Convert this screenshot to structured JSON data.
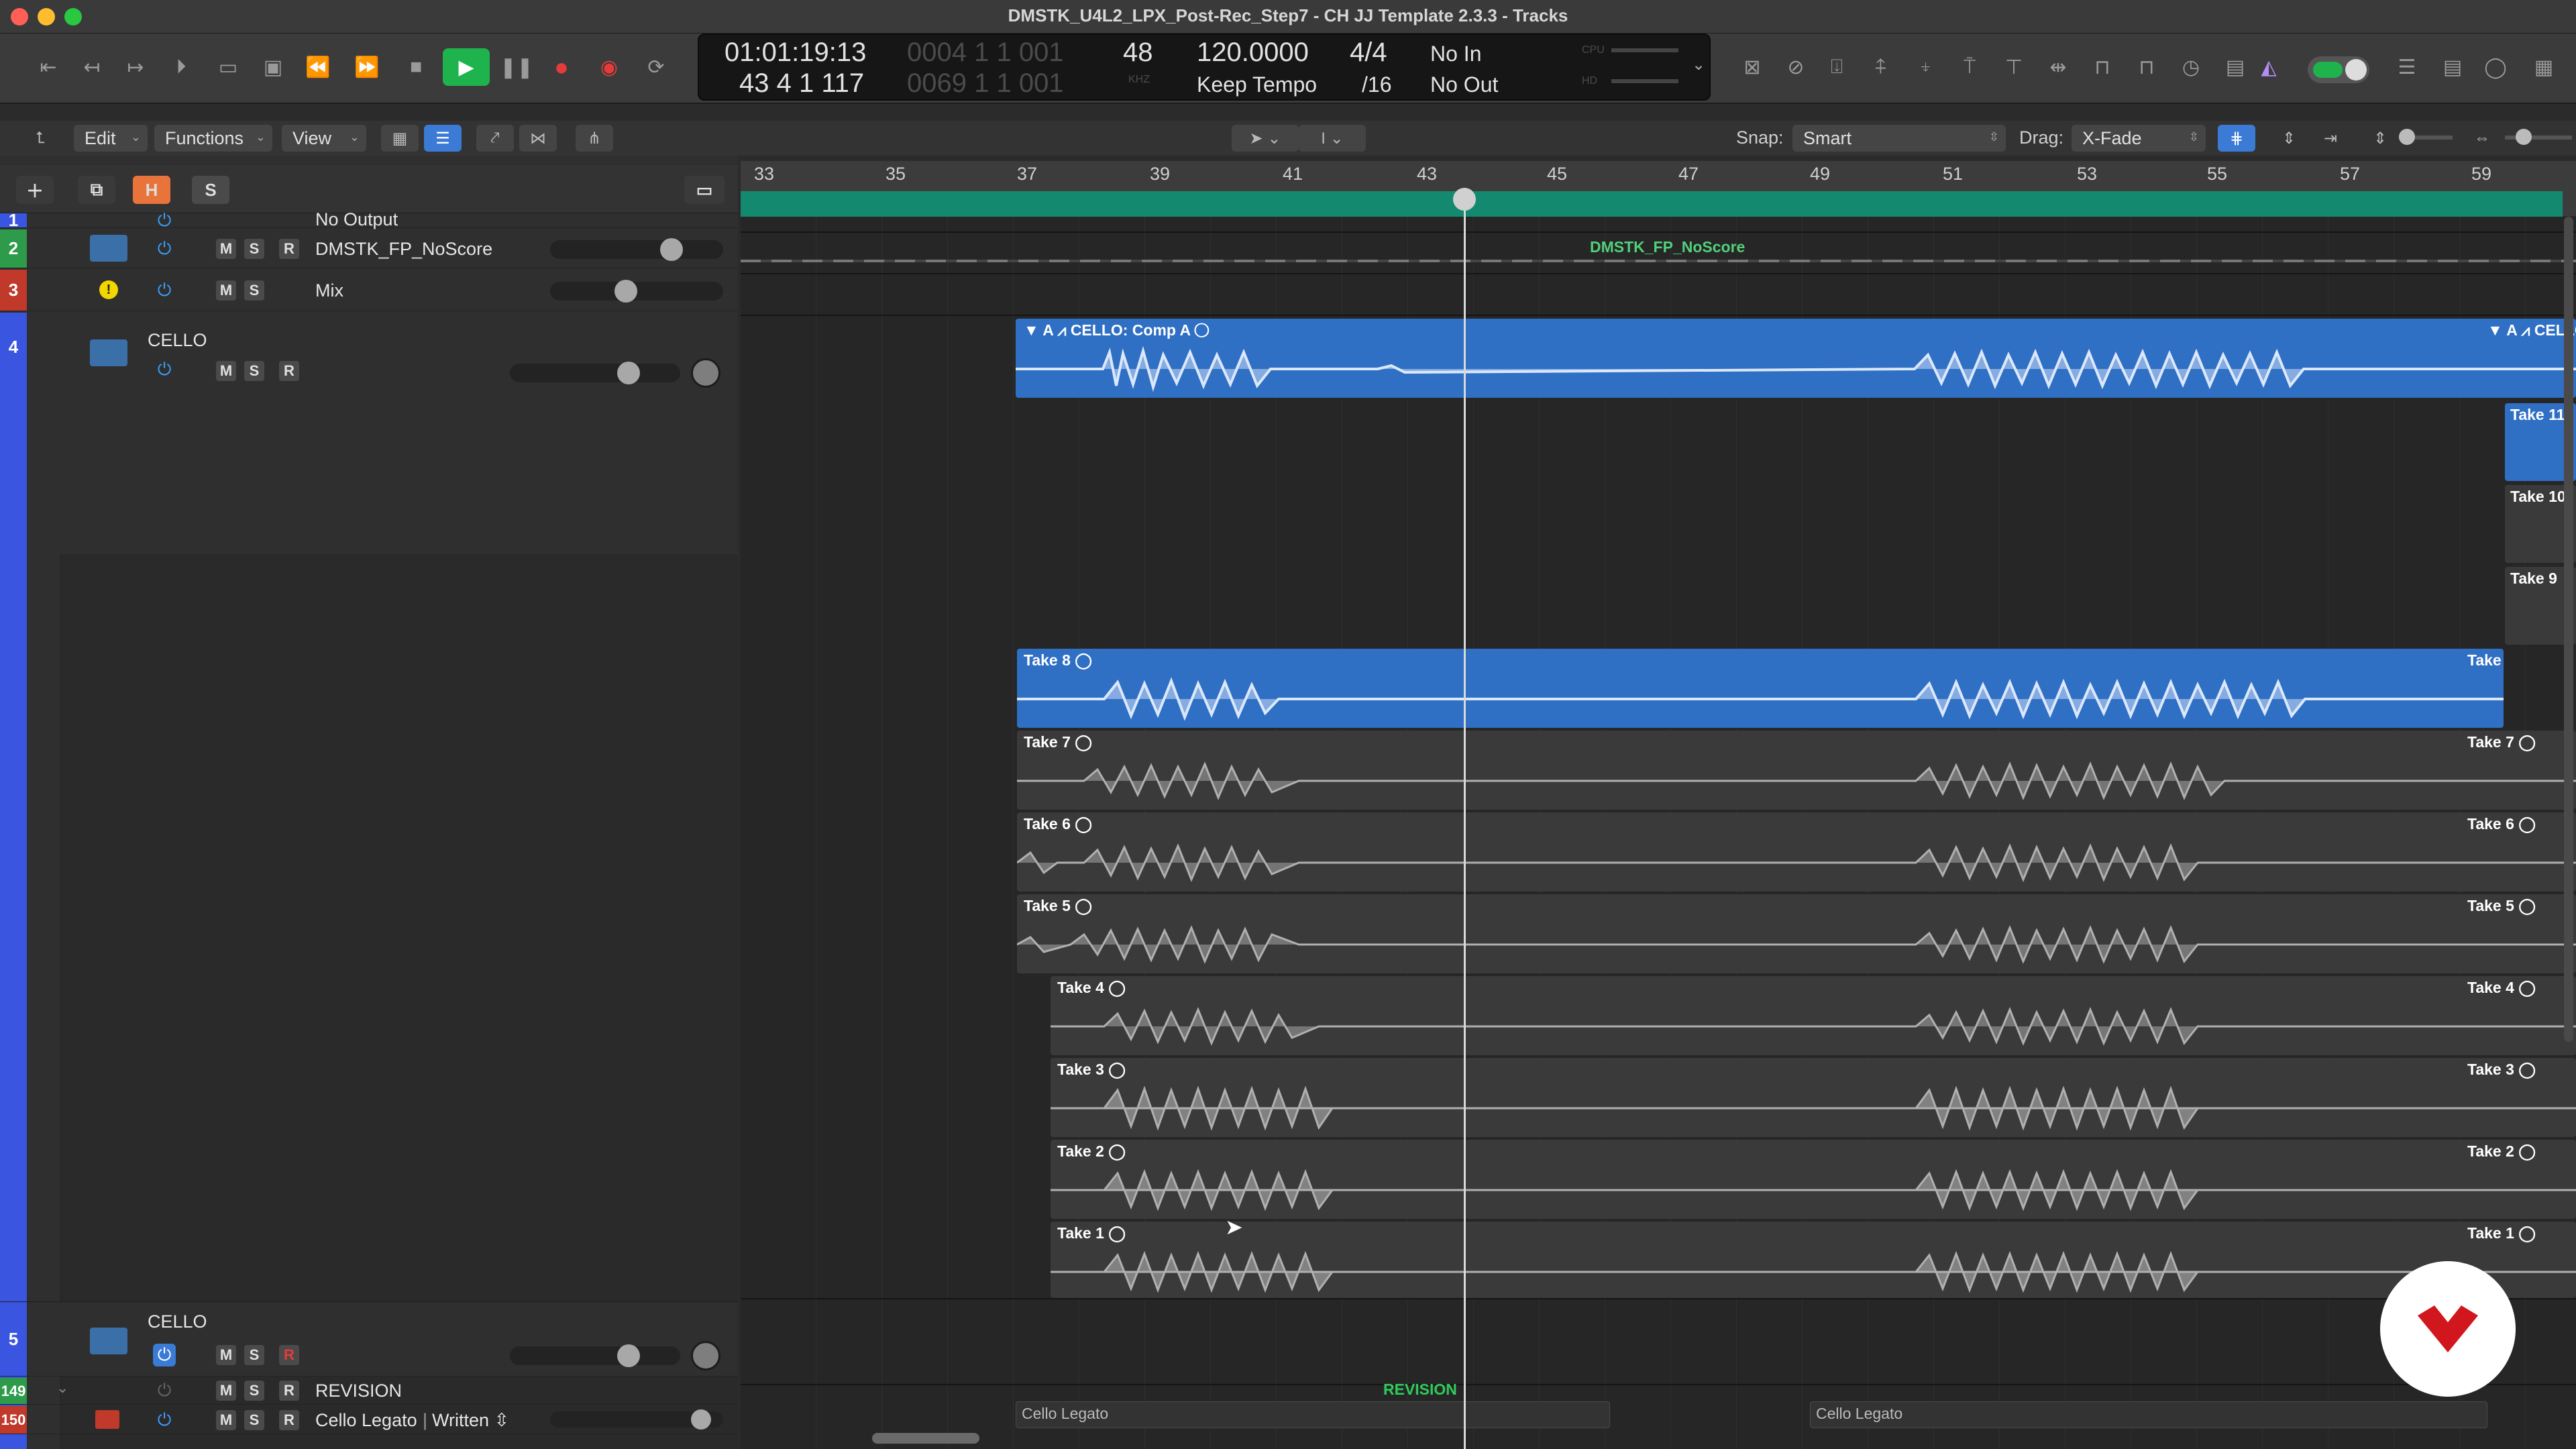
{
  "window": {
    "title": "DMSTK_U4L2_LPX_Post-Rec_Step7 - CH JJ Template 2.3.3 - Tracks",
    "traffic_colors": [
      "#ff5f57",
      "#febc2e",
      "#28c840"
    ]
  },
  "transport": {
    "smpte": "01:01:19:13",
    "bars": "43 4 1 117",
    "bars_dim_top": "0004 1 1 001",
    "bars_dim_bottom": "0069 1 1 001",
    "sample_rate": "48",
    "sample_rate_unit": "KHZ",
    "tempo": "120.0000",
    "tempo_mode": "Keep Tempo",
    "time_signature": "4/4",
    "division": "/16",
    "input": "No In",
    "output": "No Out",
    "meter_labels": [
      "CPU",
      "HD"
    ],
    "play_color": "#1fb34d",
    "record_color": "#e53b3b"
  },
  "toolbar": {
    "menus": [
      "Edit",
      "Functions",
      "View"
    ],
    "snap_label": "Snap:",
    "snap_value": "Smart",
    "drag_label": "Drag:",
    "drag_value": "X-Fade"
  },
  "global_header": {
    "buttons": [
      "H",
      "S"
    ]
  },
  "tracks": [
    {
      "number": "1",
      "name": "No Output",
      "color": "#3a55e0"
    },
    {
      "number": "2",
      "name": "DMSTK_FP_NoScore",
      "color": "#2e9b4b",
      "buttons": [
        "M",
        "S",
        "R"
      ]
    },
    {
      "number": "3",
      "name": "Mix",
      "color": "#c0392b",
      "buttons": [
        "M",
        "S"
      ]
    },
    {
      "number": "4",
      "name": "CELLO",
      "color": "#3a55e0",
      "buttons": [
        "M",
        "S",
        "R"
      ]
    },
    {
      "number": "5",
      "name": "CELLO",
      "color": "#3a55e0",
      "buttons": [
        "M",
        "S",
        "R"
      ]
    },
    {
      "number": "149",
      "name": "REVISION",
      "color": "#2e9b4b",
      "buttons": [
        "M",
        "S",
        "R"
      ]
    },
    {
      "number": "150",
      "name": "Cello Legato",
      "color": "#c0392b",
      "buttons": [
        "M",
        "S",
        "R"
      ],
      "articulation": "Written",
      "articulation_sep": "|"
    }
  ],
  "ruler": {
    "bars": [
      "33",
      "35",
      "37",
      "39",
      "41",
      "43",
      "45",
      "47",
      "49",
      "51",
      "53",
      "55",
      "57",
      "59"
    ]
  },
  "regions": {
    "dmstk_region": "DMSTK_FP_NoScore",
    "comp_label": "CELLO: Comp A",
    "comp_label_right": "CELLO: Comp",
    "takes": [
      "Take 8",
      "Take 7",
      "Take 6",
      "Take 5",
      "Take 4",
      "Take 3",
      "Take 2",
      "Take 1"
    ],
    "side_takes": [
      "Take 11",
      "Take 10",
      "Take 9"
    ],
    "revision_marker": "REVISION",
    "legato_regions": [
      "Cello Legato",
      "Cello Legato"
    ],
    "comp_color": "#2f6fc4",
    "take_color": "#3a3a3a"
  },
  "logo": {
    "name": "brand-logo",
    "color": "#d2161e"
  }
}
